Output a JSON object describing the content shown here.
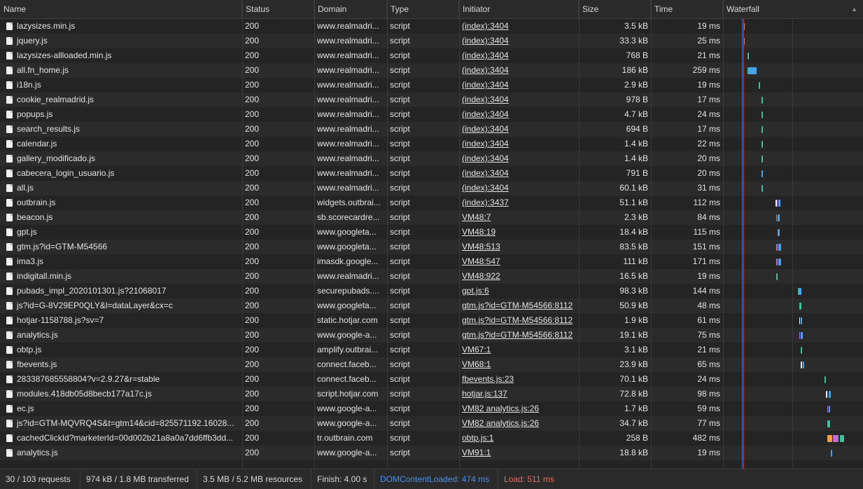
{
  "columns": {
    "name": "Name",
    "status": "Status",
    "domain": "Domain",
    "type": "Type",
    "initiator": "Initiator",
    "size": "Size",
    "time": "Time",
    "waterfall": "Waterfall",
    "sort_icon": "▲"
  },
  "colors": {
    "background": "#242424",
    "row_alt": "#2b2b2b",
    "dcl_line": "#3c6fd8",
    "load_line": "#c0473e",
    "bar_download": "#4aa3e8",
    "bar_wait": "#3fbf9a",
    "bar_queue": "#c06bd6",
    "bar_stall": "#f0a04a"
  },
  "requests": [
    {
      "name": "lazysizes.min.js",
      "status": "200",
      "domain": "www.realmadri...",
      "type": "script",
      "initiator": "(index):3404",
      "size": "3.5 kB",
      "time": "19 ms"
    },
    {
      "name": "jquery.js",
      "status": "200",
      "domain": "www.realmadri...",
      "type": "script",
      "initiator": "(index):3404",
      "size": "33.3 kB",
      "time": "25 ms"
    },
    {
      "name": "lazysizes-allloaded.min.js",
      "status": "200",
      "domain": "www.realmadri...",
      "type": "script",
      "initiator": "(index):3404",
      "size": "768 B",
      "time": "21 ms"
    },
    {
      "name": "all.fn_home.js",
      "status": "200",
      "domain": "www.realmadri...",
      "type": "script",
      "initiator": "(index):3404",
      "size": "186 kB",
      "time": "259 ms"
    },
    {
      "name": "i18n.js",
      "status": "200",
      "domain": "www.realmadri...",
      "type": "script",
      "initiator": "(index):3404",
      "size": "2.9 kB",
      "time": "19 ms"
    },
    {
      "name": "cookie_realmadrid.js",
      "status": "200",
      "domain": "www.realmadri...",
      "type": "script",
      "initiator": "(index):3404",
      "size": "978 B",
      "time": "17 ms"
    },
    {
      "name": "popups.js",
      "status": "200",
      "domain": "www.realmadri...",
      "type": "script",
      "initiator": "(index):3404",
      "size": "4.7 kB",
      "time": "24 ms"
    },
    {
      "name": "search_results.js",
      "status": "200",
      "domain": "www.realmadri...",
      "type": "script",
      "initiator": "(index):3404",
      "size": "694 B",
      "time": "17 ms"
    },
    {
      "name": "calendar.js",
      "status": "200",
      "domain": "www.realmadri...",
      "type": "script",
      "initiator": "(index):3404",
      "size": "1.4 kB",
      "time": "22 ms"
    },
    {
      "name": "gallery_modificado.js",
      "status": "200",
      "domain": "www.realmadri...",
      "type": "script",
      "initiator": "(index):3404",
      "size": "1.4 kB",
      "time": "20 ms"
    },
    {
      "name": "cabecera_login_usuario.js",
      "status": "200",
      "domain": "www.realmadri...",
      "type": "script",
      "initiator": "(index):3404",
      "size": "791 B",
      "time": "20 ms"
    },
    {
      "name": "all.js",
      "status": "200",
      "domain": "www.realmadri...",
      "type": "script",
      "initiator": "(index):3404",
      "size": "60.1 kB",
      "time": "31 ms"
    },
    {
      "name": "outbrain.js",
      "status": "200",
      "domain": "widgets.outbrai...",
      "type": "script",
      "initiator": "(index):3437",
      "size": "51.1 kB",
      "time": "112 ms"
    },
    {
      "name": "beacon.js",
      "status": "200",
      "domain": "sb.scorecardre...",
      "type": "script",
      "initiator": "VM48:7",
      "size": "2.3 kB",
      "time": "84 ms"
    },
    {
      "name": "gpt.js",
      "status": "200",
      "domain": "www.googleta...",
      "type": "script",
      "initiator": "VM48:19",
      "size": "18.4 kB",
      "time": "115 ms"
    },
    {
      "name": "gtm.js?id=GTM-M54566",
      "status": "200",
      "domain": "www.googleta...",
      "type": "script",
      "initiator": "VM48:513",
      "size": "83.5 kB",
      "time": "151 ms"
    },
    {
      "name": "ima3.js",
      "status": "200",
      "domain": "imasdk.google...",
      "type": "script",
      "initiator": "VM48:547",
      "size": "111 kB",
      "time": "171 ms"
    },
    {
      "name": "indigitall.min.js",
      "status": "200",
      "domain": "www.realmadri...",
      "type": "script",
      "initiator": "VM48:922",
      "size": "16.5 kB",
      "time": "19 ms"
    },
    {
      "name": "pubads_impl_2020101301.js?21068017",
      "status": "200",
      "domain": "securepubads....",
      "type": "script",
      "initiator": "gpt.js:6",
      "size": "98.3 kB",
      "time": "144 ms"
    },
    {
      "name": "js?id=G-8V29EP0QLY&l=dataLayer&cx=c",
      "status": "200",
      "domain": "www.googleta...",
      "type": "script",
      "initiator": "gtm.js?id=GTM-M54566:8112",
      "size": "50.9 kB",
      "time": "48 ms"
    },
    {
      "name": "hotjar-1158788.js?sv=7",
      "status": "200",
      "domain": "static.hotjar.com",
      "type": "script",
      "initiator": "gtm.js?id=GTM-M54566:8112",
      "size": "1.9 kB",
      "time": "61 ms"
    },
    {
      "name": "analytics.js",
      "status": "200",
      "domain": "www.google-a...",
      "type": "script",
      "initiator": "gtm.js?id=GTM-M54566:8112",
      "size": "19.1 kB",
      "time": "75 ms"
    },
    {
      "name": "obtp.js",
      "status": "200",
      "domain": "amplify.outbrai...",
      "type": "script",
      "initiator": "VM67:1",
      "size": "3.1 kB",
      "time": "21 ms"
    },
    {
      "name": "fbevents.js",
      "status": "200",
      "domain": "connect.faceb...",
      "type": "script",
      "initiator": "VM68:1",
      "size": "23.9 kB",
      "time": "65 ms"
    },
    {
      "name": "283387685558804?v=2.9.27&r=stable",
      "status": "200",
      "domain": "connect.faceb...",
      "type": "script",
      "initiator": "fbevents.js:23",
      "size": "70.1 kB",
      "time": "24 ms"
    },
    {
      "name": "modules.418db05d8becb177a17c.js",
      "status": "200",
      "domain": "script.hotjar.com",
      "type": "script",
      "initiator": "hotjar.js:137",
      "size": "72.8 kB",
      "time": "98 ms"
    },
    {
      "name": "ec.js",
      "status": "200",
      "domain": "www.google-a...",
      "type": "script",
      "initiator": "VM82 analytics.js:26",
      "size": "1.7 kB",
      "time": "59 ms"
    },
    {
      "name": "js?id=GTM-MQVRQ4S&t=gtm14&cid=825571192.16028...",
      "status": "200",
      "domain": "www.google-a...",
      "type": "script",
      "initiator": "VM82 analytics.js:26",
      "size": "34.7 kB",
      "time": "77 ms"
    },
    {
      "name": "cachedClickId?marketerId=00d002b21a8a0a7dd6ffb3dd...",
      "status": "200",
      "domain": "tr.outbrain.com",
      "type": "script",
      "initiator": "obtp.js:1",
      "size": "258 B",
      "time": "482 ms"
    },
    {
      "name": "analytics.js",
      "status": "200",
      "domain": "www.google-a...",
      "type": "script",
      "initiator": "VM91:1",
      "size": "18.8 kB",
      "time": "19 ms"
    }
  ],
  "waterfall": [
    [
      {
        "c": "#4aa3e8",
        "s": 0.0,
        "w": 2
      }
    ],
    [
      {
        "c": "#4aa3e8",
        "s": 0.0,
        "w": 2
      }
    ],
    [
      {
        "c": "#3fbf9a",
        "s": 0.08,
        "w": 2
      }
    ],
    [
      {
        "c": "#3fbf9a",
        "s": 0.08,
        "w": 2
      },
      {
        "c": "#4aa3e8",
        "s": 0.1,
        "w": 11
      }
    ],
    [
      {
        "c": "#3fbf9a",
        "s": 0.27,
        "w": 2
      }
    ],
    [
      {
        "c": "#3fbf9a",
        "s": 0.33,
        "w": 2
      }
    ],
    [
      {
        "c": "#3fbf9a",
        "s": 0.33,
        "w": 2
      }
    ],
    [
      {
        "c": "#3fbf9a",
        "s": 0.33,
        "w": 2
      }
    ],
    [
      {
        "c": "#3fbf9a",
        "s": 0.33,
        "w": 2
      }
    ],
    [
      {
        "c": "#3fbf9a",
        "s": 0.33,
        "w": 2
      }
    ],
    [
      {
        "c": "#4aa3e8",
        "s": 0.33,
        "w": 2
      }
    ],
    [
      {
        "c": "#3fbf9a",
        "s": 0.33,
        "w": 2
      }
    ],
    [
      {
        "c": "#f0f0f0",
        "s": 0.58,
        "w": 2
      },
      {
        "c": "#c06bd6",
        "s": 0.6,
        "w": 1
      },
      {
        "c": "#4aa3e8",
        "s": 0.62,
        "w": 3
      }
    ],
    [
      {
        "c": "#c06bd6",
        "s": 0.59,
        "w": 1
      },
      {
        "c": "#4aa3e8",
        "s": 0.61,
        "w": 3
      }
    ],
    [
      {
        "c": "#3fbf9a",
        "s": 0.61,
        "w": 2
      },
      {
        "c": "#4aa3e8",
        "s": 0.63,
        "w": 2
      }
    ],
    [
      {
        "c": "#c06bd6",
        "s": 0.59,
        "w": 2
      },
      {
        "c": "#4aa3e8",
        "s": 0.62,
        "w": 4
      }
    ],
    [
      {
        "c": "#c06bd6",
        "s": 0.59,
        "w": 2
      },
      {
        "c": "#4aa3e8",
        "s": 0.62,
        "w": 4
      }
    ],
    [
      {
        "c": "#3fbf9a",
        "s": 0.59,
        "w": 2
      }
    ],
    [
      {
        "c": "#3fbf9a",
        "s": 0.97,
        "w": 2
      },
      {
        "c": "#4aa3e8",
        "s": 0.99,
        "w": 4
      }
    ],
    [
      {
        "c": "#3fbf9a",
        "s": 1.0,
        "w": 3
      }
    ],
    [
      {
        "c": "#f0f0f0",
        "s": 1.0,
        "w": 1
      },
      {
        "c": "#4aa3e8",
        "s": 1.02,
        "w": 2
      }
    ],
    [
      {
        "c": "#c06bd6",
        "s": 1.0,
        "w": 1
      },
      {
        "c": "#4aa3e8",
        "s": 1.02,
        "w": 3
      }
    ],
    [
      {
        "c": "#3fbf9a",
        "s": 1.02,
        "w": 2
      }
    ],
    [
      {
        "c": "#f0f0f0",
        "s": 1.03,
        "w": 2
      },
      {
        "c": "#4aa3e8",
        "s": 1.06,
        "w": 2
      }
    ],
    [
      {
        "c": "#3fbf9a",
        "s": 1.45,
        "w": 2
      }
    ],
    [
      {
        "c": "#f0f0f0",
        "s": 1.48,
        "w": 2
      },
      {
        "c": "#4aa3e8",
        "s": 1.52,
        "w": 3
      }
    ],
    [
      {
        "c": "#c06bd6",
        "s": 1.5,
        "w": 1
      },
      {
        "c": "#4aa3e8",
        "s": 1.52,
        "w": 2
      }
    ],
    [
      {
        "c": "#3fbf9a",
        "s": 1.5,
        "w": 4
      }
    ],
    [
      {
        "c": "#f0a04a",
        "s": 1.5,
        "w": 7
      },
      {
        "c": "#c06bd6",
        "s": 1.6,
        "w": 8
      },
      {
        "c": "#3fbf9a",
        "s": 1.73,
        "w": 6
      }
    ],
    [
      {
        "c": "#4aa3e8",
        "s": 1.56,
        "w": 2
      }
    ]
  ],
  "status_bar": {
    "requests": "30 / 103 requests",
    "transferred": "974 kB / 1.8 MB transferred",
    "resources": "3.5 MB / 5.2 MB resources",
    "finish": "Finish: 4.00 s",
    "dcl": "DOMContentLoaded: 474 ms",
    "load": "Load: 511 ms"
  }
}
